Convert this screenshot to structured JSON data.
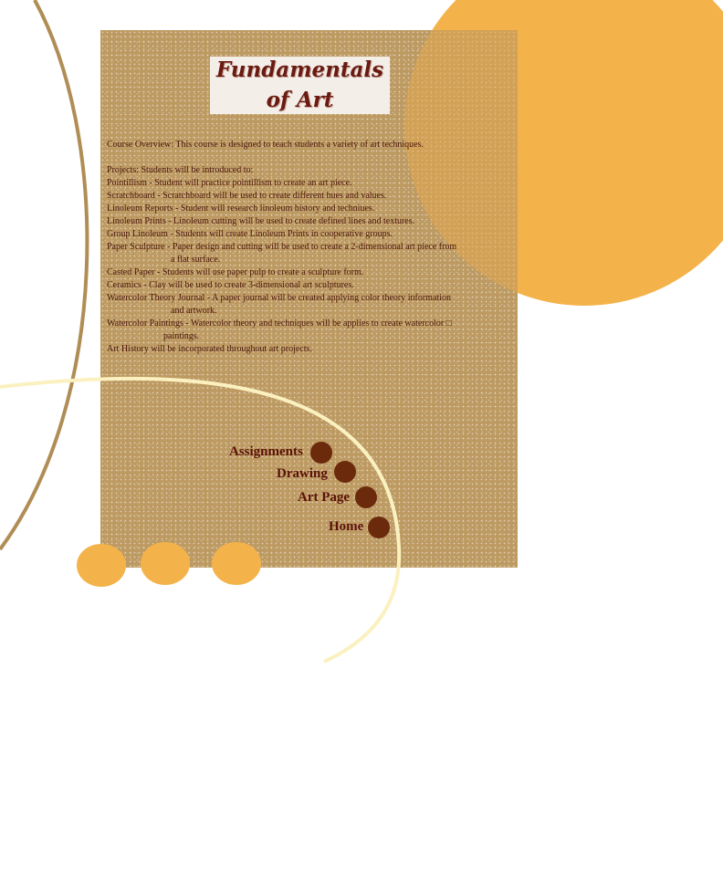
{
  "title": {
    "line1": "Fundamentals",
    "line2": "of Art"
  },
  "overview": "Course Overview:  This course is designed to teach students a variety of art techniques.",
  "projects_intro": "Projects:  Students will be introduced to:",
  "projects": [
    {
      "text": "Pointillism - Student will practice pointillism to create an art piece.",
      "cont": ""
    },
    {
      "text": "Scratchboard - Scratchboard will be used to create different hues and values.",
      "cont": ""
    },
    {
      "text": "Linoleum Reports - Student will research linoleum history and techniues.",
      "cont": ""
    },
    {
      "text": "Linoleum Prints - Linoleum cutting will be used to create defined lines and textures.",
      "cont": ""
    },
    {
      "text": "Group Linoleum - Students will create Linoleum Prints in cooperative groups.",
      "cont": ""
    },
    {
      "text": "Paper Sculpture - Paper design and cutting will be used to create a 2-dimensional art piece from",
      "cont": "a flat surface."
    },
    {
      "text": "Casted Paper - Students will use paper pulp to create a sculpture form.",
      "cont": ""
    },
    {
      "text": "Ceramics - Clay will be used to create 3-dimensional art sculptures.",
      "cont": ""
    },
    {
      "text": "Watercolor Theory Journal - A paper journal will be created applying color theory information",
      "cont": "and artwork."
    },
    {
      "text": "Watercolor Paintings - Watercolor theory and techniques will be applies to create watercolor □",
      "cont": "paintings."
    }
  ],
  "closing": "Art History will be incorporated throughout art projects.",
  "nav": [
    {
      "label": "Assignments"
    },
    {
      "label": "Drawing"
    },
    {
      "label": "Art Page"
    },
    {
      "label": "Home"
    }
  ],
  "colors": {
    "panel": "#bd9a62",
    "sun": "#f4b24a",
    "title_text": "#6a1a10",
    "nav_dot": "#6b2a0c",
    "curve_light": "#fbf1c0",
    "curve_dark": "#b08d55"
  }
}
